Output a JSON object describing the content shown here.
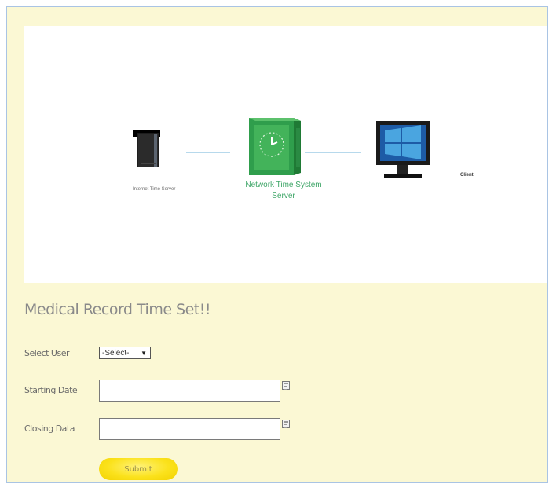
{
  "diagram": {
    "internet_time_server_label": "Internet Time Server",
    "network_time_server_label_line1": "Network Time System",
    "network_time_server_label_line2": "Server",
    "client_label": "Client"
  },
  "form": {
    "title": "Medical Record Time Set!!",
    "select_user_label": "Select User",
    "select_user_value": "-Select-",
    "starting_date_label": "Starting Date",
    "starting_date_value": "",
    "closing_date_label": "Closing Data",
    "closing_date_value": "",
    "submit_label": "Submit"
  },
  "colors": {
    "page_background": "#fbf8d4",
    "accent_green": "#3fa668",
    "submit_yellow": "#fbe21c"
  }
}
